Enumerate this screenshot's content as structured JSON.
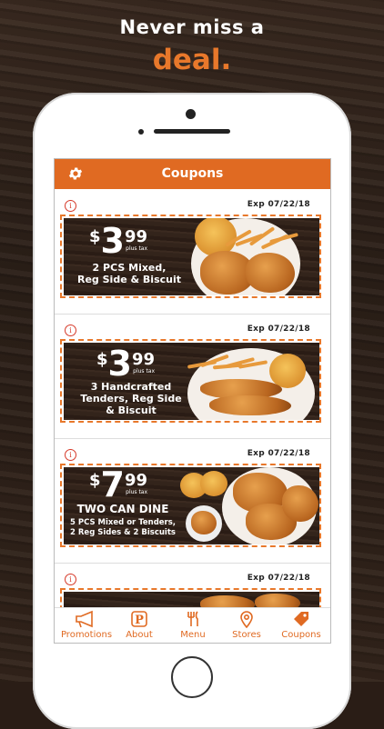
{
  "promo": {
    "line1": "Never miss a",
    "line2": "deal."
  },
  "header": {
    "title": "Coupons",
    "settings_icon": "gear-icon"
  },
  "coupons": [
    {
      "exp": "Exp 07/22/18",
      "dollars": "3",
      "cents": "99",
      "tax": "plus tax",
      "desc_lines": [
        "2 PCS Mixed,",
        "Reg Side & Biscuit"
      ]
    },
    {
      "exp": "Exp 07/22/18",
      "dollars": "3",
      "cents": "99",
      "tax": "plus tax",
      "desc_lines": [
        "3 Handcrafted",
        "Tenders, Reg Side",
        "& Biscuit"
      ]
    },
    {
      "exp": "Exp 07/22/18",
      "dollars": "7",
      "cents": "99",
      "tax": "plus tax",
      "headline": "TWO CAN DINE",
      "desc_lines": [
        "5 PCS Mixed or Tenders,",
        "2 Reg Sides & 2 Biscuits"
      ]
    },
    {
      "exp": "Exp 07/22/18",
      "dollars": "",
      "cents": "",
      "tax": "",
      "desc_lines": []
    }
  ],
  "tabs": [
    {
      "label": "Promotions",
      "icon": "megaphone-icon"
    },
    {
      "label": "About",
      "icon": "popeyes-p-icon"
    },
    {
      "label": "Menu",
      "icon": "fork-knife-icon"
    },
    {
      "label": "Stores",
      "icon": "location-pin-icon"
    },
    {
      "label": "Coupons",
      "icon": "coupon-tag-icon"
    }
  ],
  "colors": {
    "accent": "#e06a22",
    "deal": "#e8782b",
    "info": "#d63a2a"
  }
}
